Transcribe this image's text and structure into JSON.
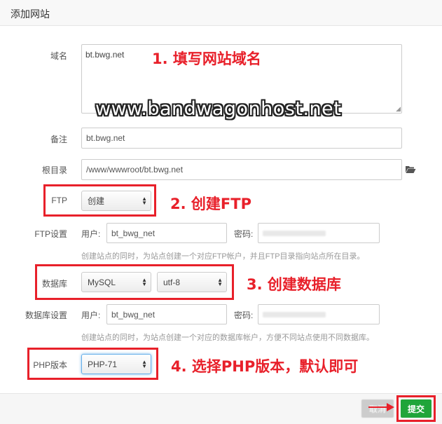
{
  "dialog": {
    "title": "添加网站"
  },
  "form": {
    "domain_label": "域名",
    "domain_value": "bt.bwg.net",
    "note_label": "备注",
    "note_value": "bt.bwg.net",
    "root_label": "根目录",
    "root_value": "/www/wwwroot/bt.bwg.net",
    "ftp_label": "FTP",
    "ftp_select": "创建",
    "ftp_settings_label": "FTP设置",
    "ftp_user_label": "用户:",
    "ftp_user_value": "bt_bwg_net",
    "ftp_pass_label": "密码:",
    "ftp_hint": "创建站点的同时，为站点创建一个对应FTP帐户，并且FTP目录指向站点所在目录。",
    "db_label": "数据库",
    "db_select": "MySQL",
    "db_charset_select": "utf-8",
    "db_settings_label": "数据库设置",
    "db_user_label": "用户:",
    "db_user_value": "bt_bwg_net",
    "db_pass_label": "密码:",
    "db_hint": "创建站点的同时，为站点创建一个对应的数据库帐户，方便不同站点使用不同数据库。",
    "php_label": "PHP版本",
    "php_select": "PHP-71"
  },
  "annotations": {
    "step1": "1. 填写网站域名",
    "step2": "2. 创建FTP",
    "step3": "3. 创建数据库",
    "step4": "4. 选择PHP版本，默认即可",
    "watermark": "www.bandwagonhost.net"
  },
  "footer": {
    "cancel_label": "取消",
    "submit_label": "提交"
  },
  "colors": {
    "accent_red": "#e8202a",
    "submit_green": "#20a53a"
  },
  "icons": {
    "folder": "folder-icon",
    "arrow": "arrow-right-icon"
  }
}
